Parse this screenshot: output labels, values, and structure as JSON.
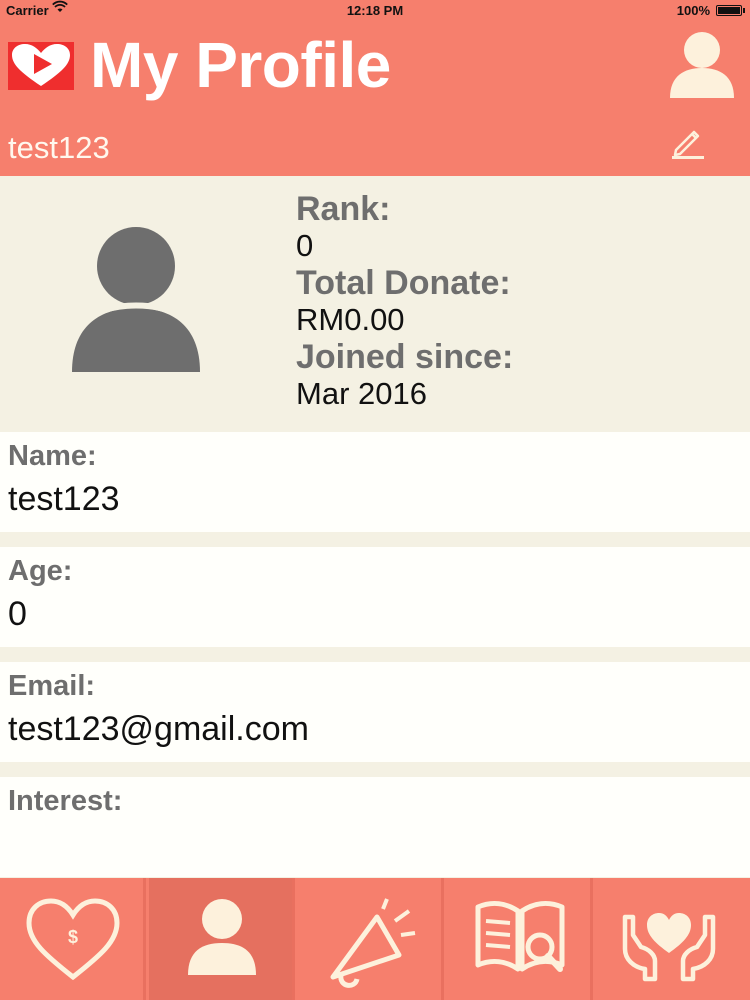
{
  "status_bar": {
    "carrier": "Carrier",
    "time": "12:18 PM",
    "battery": "100%"
  },
  "header": {
    "title": "My Profile",
    "username": "test123",
    "logo_icon": "heart-play-logo",
    "profile_icon": "user-icon",
    "edit_icon": "pencil-icon"
  },
  "summary": {
    "avatar_icon": "user-avatar-icon",
    "rank_label": "Rank:",
    "rank_value": "0",
    "donate_label": "Total Donate:",
    "donate_value": "RM0.00",
    "joined_label": "Joined since:",
    "joined_value": "Mar 2016"
  },
  "fields": {
    "name": {
      "label": "Name:",
      "value": "test123"
    },
    "age": {
      "label": "Age:",
      "value": "0"
    },
    "email": {
      "label": "Email:",
      "value": "test123@gmail.com"
    },
    "interest": {
      "label": "Interest:",
      "value": ""
    }
  },
  "tabbar": {
    "tabs": [
      {
        "icon": "heart-dollar-icon",
        "active": false
      },
      {
        "icon": "user-icon",
        "active": true
      },
      {
        "icon": "megaphone-icon",
        "active": false
      },
      {
        "icon": "book-search-icon",
        "active": false
      },
      {
        "icon": "hands-heart-icon",
        "active": false
      }
    ]
  },
  "colors": {
    "header": "#f67f6d",
    "panel": "#f4f1e3",
    "field": "#fffffb",
    "icon": "#fdf1dc",
    "avatar": "#6e6e6e"
  }
}
